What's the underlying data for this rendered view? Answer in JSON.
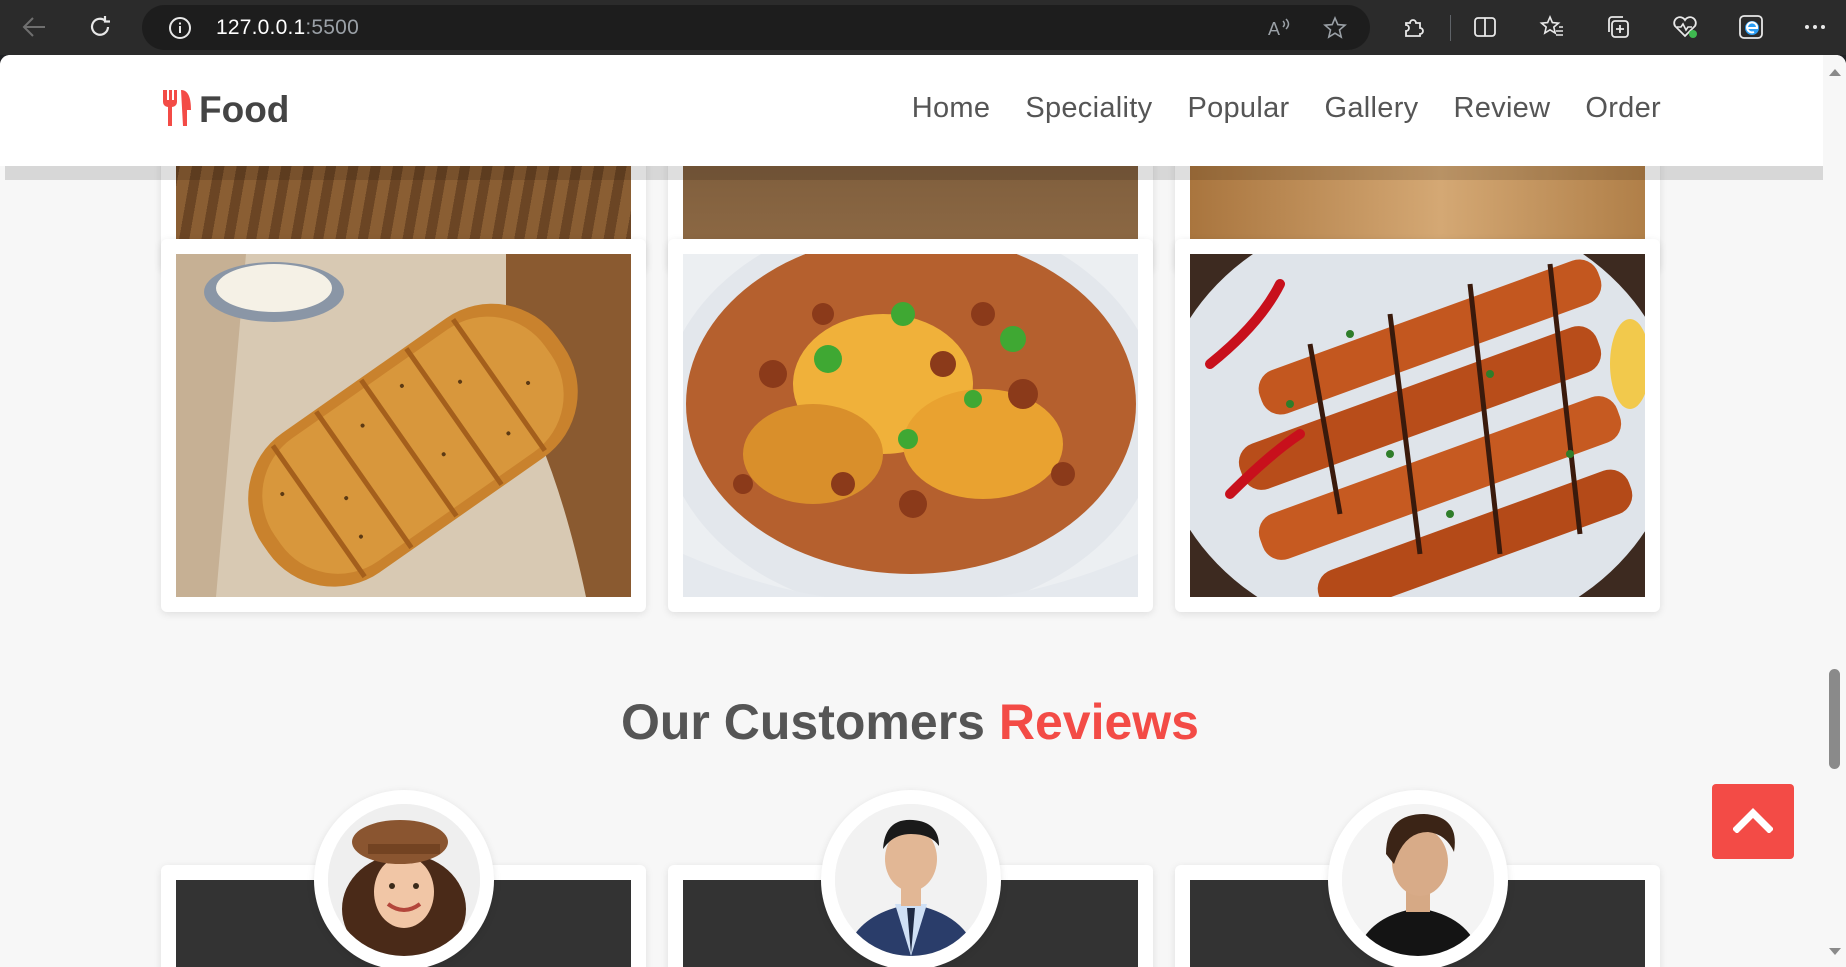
{
  "browser": {
    "url_host": "127.0.0.1",
    "url_port": ":5500",
    "icons": [
      "back-icon",
      "refresh-icon",
      "info-icon",
      "read-aloud-icon",
      "favorite-star-icon",
      "extensions-icon",
      "split-screen-icon",
      "favorites-icon",
      "collections-icon",
      "browser-essentials-icon",
      "edge-icon",
      "more-icon"
    ]
  },
  "site": {
    "logo_text": "Food",
    "nav": [
      "Home",
      "Speciality",
      "Popular",
      "Gallery",
      "Review",
      "Order"
    ]
  },
  "gallery": {
    "images": [
      "garlic-bread",
      "cabbage-mince-bowl",
      "chicken-skewers"
    ]
  },
  "reviews": {
    "heading_main": "Our Customers ",
    "heading_accent": "Reviews",
    "customers": [
      "woman-with-cap",
      "man-in-suit",
      "man-in-black-shirt"
    ]
  },
  "colors": {
    "accent": "#f34b46",
    "text": "#555555",
    "dark_card": "#333333"
  }
}
